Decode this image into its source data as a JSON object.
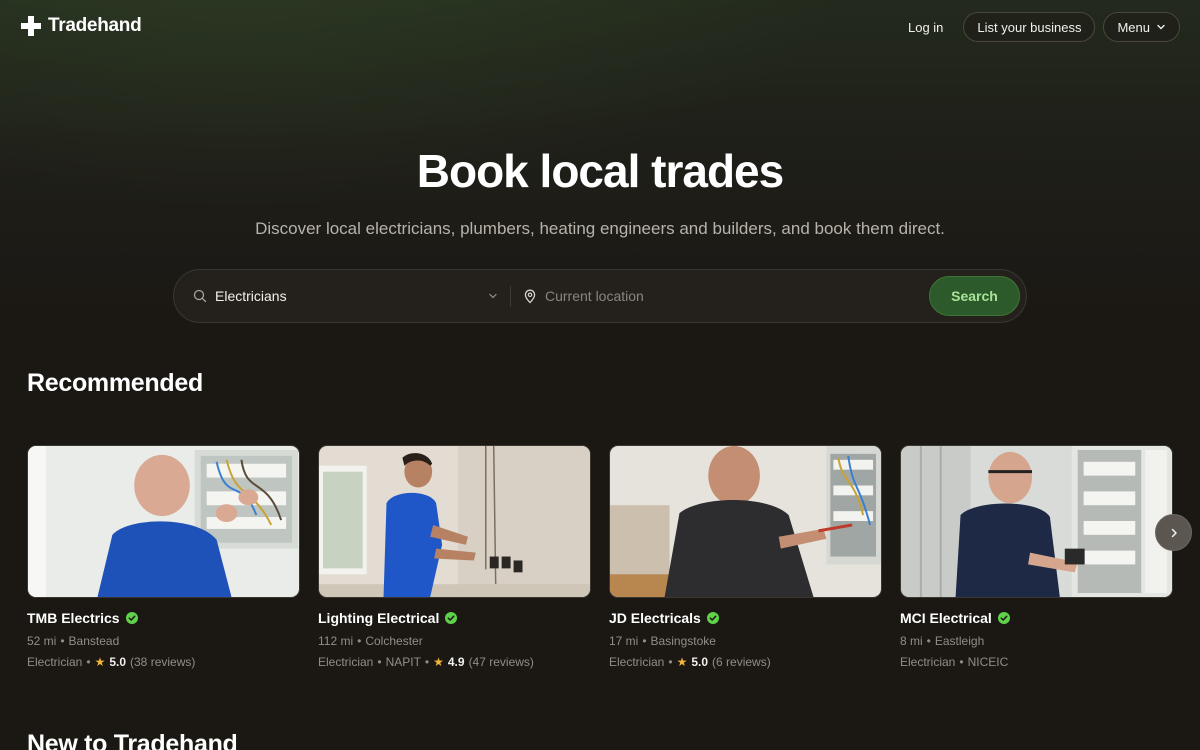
{
  "header": {
    "brand": "Tradehand",
    "login_label": "Log in",
    "list_business_label": "List your business",
    "menu_label": "Menu"
  },
  "hero": {
    "title": "Book local trades",
    "subtitle": "Discover local electricians, plumbers, heating engineers and builders, and book them direct."
  },
  "search": {
    "trade_value": "Electricians",
    "location_placeholder": "Current location",
    "button_label": "Search"
  },
  "recommended": {
    "title": "Recommended",
    "cards": [
      {
        "name": "TMB Electrics",
        "distance": "52 mi",
        "town": "Banstead",
        "trade": "Electrician",
        "accreditation": "",
        "rating": "5.0",
        "reviews": "(38 reviews)"
      },
      {
        "name": "Lighting Electrical",
        "distance": "112 mi",
        "town": "Colchester",
        "trade": "Electrician",
        "accreditation": "NAPIT",
        "rating": "4.9",
        "reviews": "(47 reviews)"
      },
      {
        "name": "JD Electricals",
        "distance": "17 mi",
        "town": "Basingstoke",
        "trade": "Electrician",
        "accreditation": "",
        "rating": "5.0",
        "reviews": "(6 reviews)"
      },
      {
        "name": "MCI Electrical",
        "distance": "8 mi",
        "town": "Eastleigh",
        "trade": "Electrician",
        "accreditation": "NICEIC",
        "rating": "",
        "reviews": ""
      }
    ]
  },
  "new_section": {
    "title": "New to Tradehand"
  },
  "colors": {
    "accent_green": "#2d5a2a",
    "verified_green": "#5fd14a",
    "star": "#f3b43a",
    "background": "#1b1814"
  }
}
